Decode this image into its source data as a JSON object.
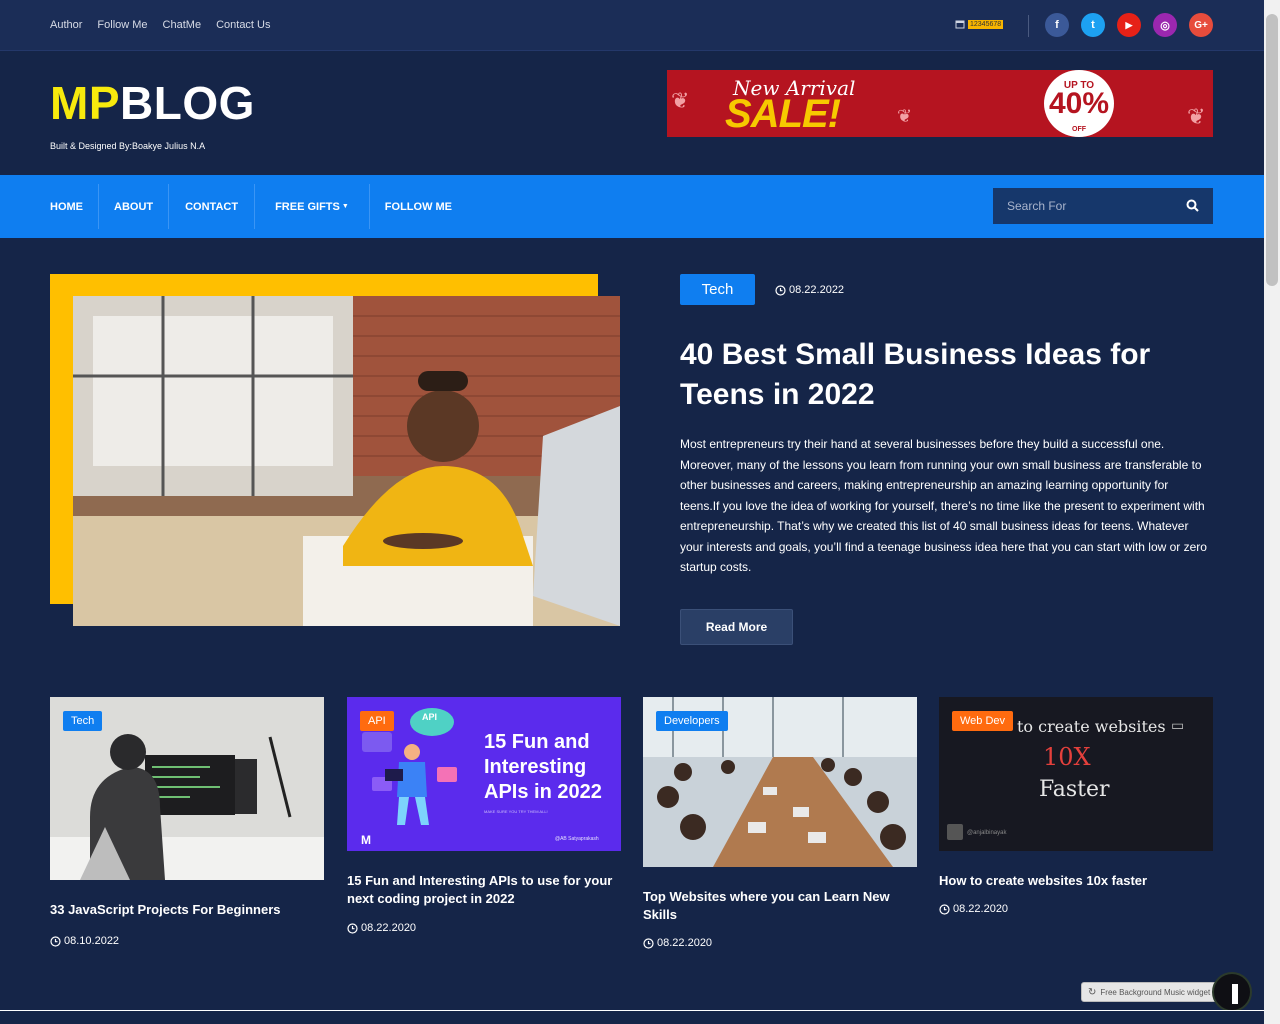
{
  "topbar": {
    "links": [
      "Author",
      "Follow Me",
      "ChatMe",
      "Contact Us"
    ],
    "date_value": "12345678",
    "social": [
      {
        "icon": "facebook-icon",
        "glyph": "f",
        "color": "#3b5998"
      },
      {
        "icon": "twitter-icon",
        "glyph": "t",
        "color": "#1da1f2"
      },
      {
        "icon": "youtube-icon",
        "glyph": "▶",
        "color": "#e62117"
      },
      {
        "icon": "instagram-icon",
        "glyph": "◎",
        "color": "#9b27af"
      },
      {
        "icon": "google-plus-icon",
        "glyph": "G+",
        "color": "#e74c3c"
      }
    ]
  },
  "header": {
    "logo_mp": "MP",
    "logo_blog": "BLOG",
    "byline": "Built & Designed By:Boakye Julius N.A",
    "banner": {
      "new_arrival": "New Arrival",
      "sale": "SALE!",
      "up_to": "UP TO",
      "percent": "40%",
      "off": "OFF"
    }
  },
  "nav": {
    "items": [
      "HOME",
      "ABOUT",
      "CONTACT",
      "FREE GIFTS",
      "FOLLOW ME"
    ],
    "search_placeholder": "Search For"
  },
  "featured": {
    "tag": "Tech",
    "date": "08.22.2022",
    "title": "40 Best Small Business Ideas for Teens in 2022",
    "excerpt": "Most entrepreneurs try their hand at several businesses before they build a successful one. Moreover, many of the lessons you learn from running your own small business are transferable to other businesses and careers, making entrepreneurship an amazing learning opportunity for teens.If you love the idea of working for yourself, there’s no time like the present to experiment with entrepreneurship. That’s why we created this list of 40 small business ideas for teens. Whatever your interests and goals, you’ll find a teenage business idea here that you can start with low or zero startup costs.",
    "read_more": "Read More"
  },
  "cards": [
    {
      "tag": "Tech",
      "tag_color": "#0f7ef0",
      "title": "33 JavaScript Projects For Beginners",
      "date": "08.10.2022"
    },
    {
      "tag": "API",
      "tag_color": "#ff6b0f",
      "title": "15 Fun and Interesting APIs to use for your next coding project in 2022",
      "date": "08.22.2020",
      "thumb_text": {
        "headline": "15 Fun and Interesting APIs in 2022",
        "sub": "MAKE SURE YOU TRY THEM ALL!",
        "badge": "API",
        "author": "@AB Satyaprakash",
        "logo": "M"
      }
    },
    {
      "tag": "Developers",
      "tag_color": "#0f7ef0",
      "title": "Top Websites where you can Learn New Skills",
      "date": "08.22.2020"
    },
    {
      "tag": "Web Dev",
      "tag_color": "#ff6b0f",
      "title": "How to create websites 10x faster",
      "date": "08.22.2020",
      "thumb_text": {
        "line1": "to create websites",
        "line2": "10X",
        "line3": "Faster",
        "handle": "@anjalbinayak"
      }
    }
  ],
  "widget": {
    "music": "Free Background Music widget"
  }
}
